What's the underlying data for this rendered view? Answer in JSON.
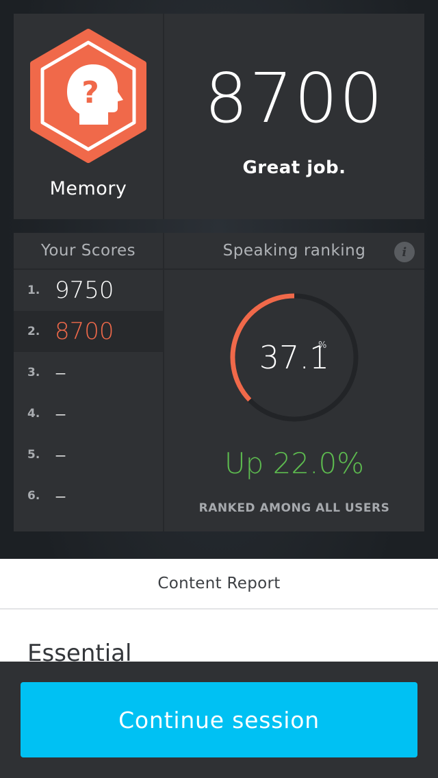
{
  "summary": {
    "category": "Memory",
    "category_icon": "memory-head-question-icon",
    "score": "8700",
    "praise": "Great job.",
    "accent_color": "#f0694a"
  },
  "scores": {
    "header": "Your Scores",
    "rows": [
      {
        "rank": "1.",
        "value": "9750",
        "active": false
      },
      {
        "rank": "2.",
        "value": "8700",
        "active": true
      },
      {
        "rank": "3.",
        "value": "–",
        "active": false
      },
      {
        "rank": "4.",
        "value": "–",
        "active": false
      },
      {
        "rank": "5.",
        "value": "–",
        "active": false
      },
      {
        "rank": "6.",
        "value": "–",
        "active": false
      }
    ]
  },
  "ranking": {
    "header": "Speaking ranking",
    "info_icon": "info-icon",
    "percentile_value": "37.1",
    "percentile_unit": "%",
    "percentile_fraction": 0.371,
    "trend": "Up 22.0%",
    "trend_color": "#5dbb4f",
    "caption": "RANKED AMONG ALL USERS"
  },
  "report": {
    "header": "Content Report",
    "section_title": "Essential"
  },
  "actions": {
    "continue_label": "Continue session",
    "button_color": "#00c1f3"
  }
}
